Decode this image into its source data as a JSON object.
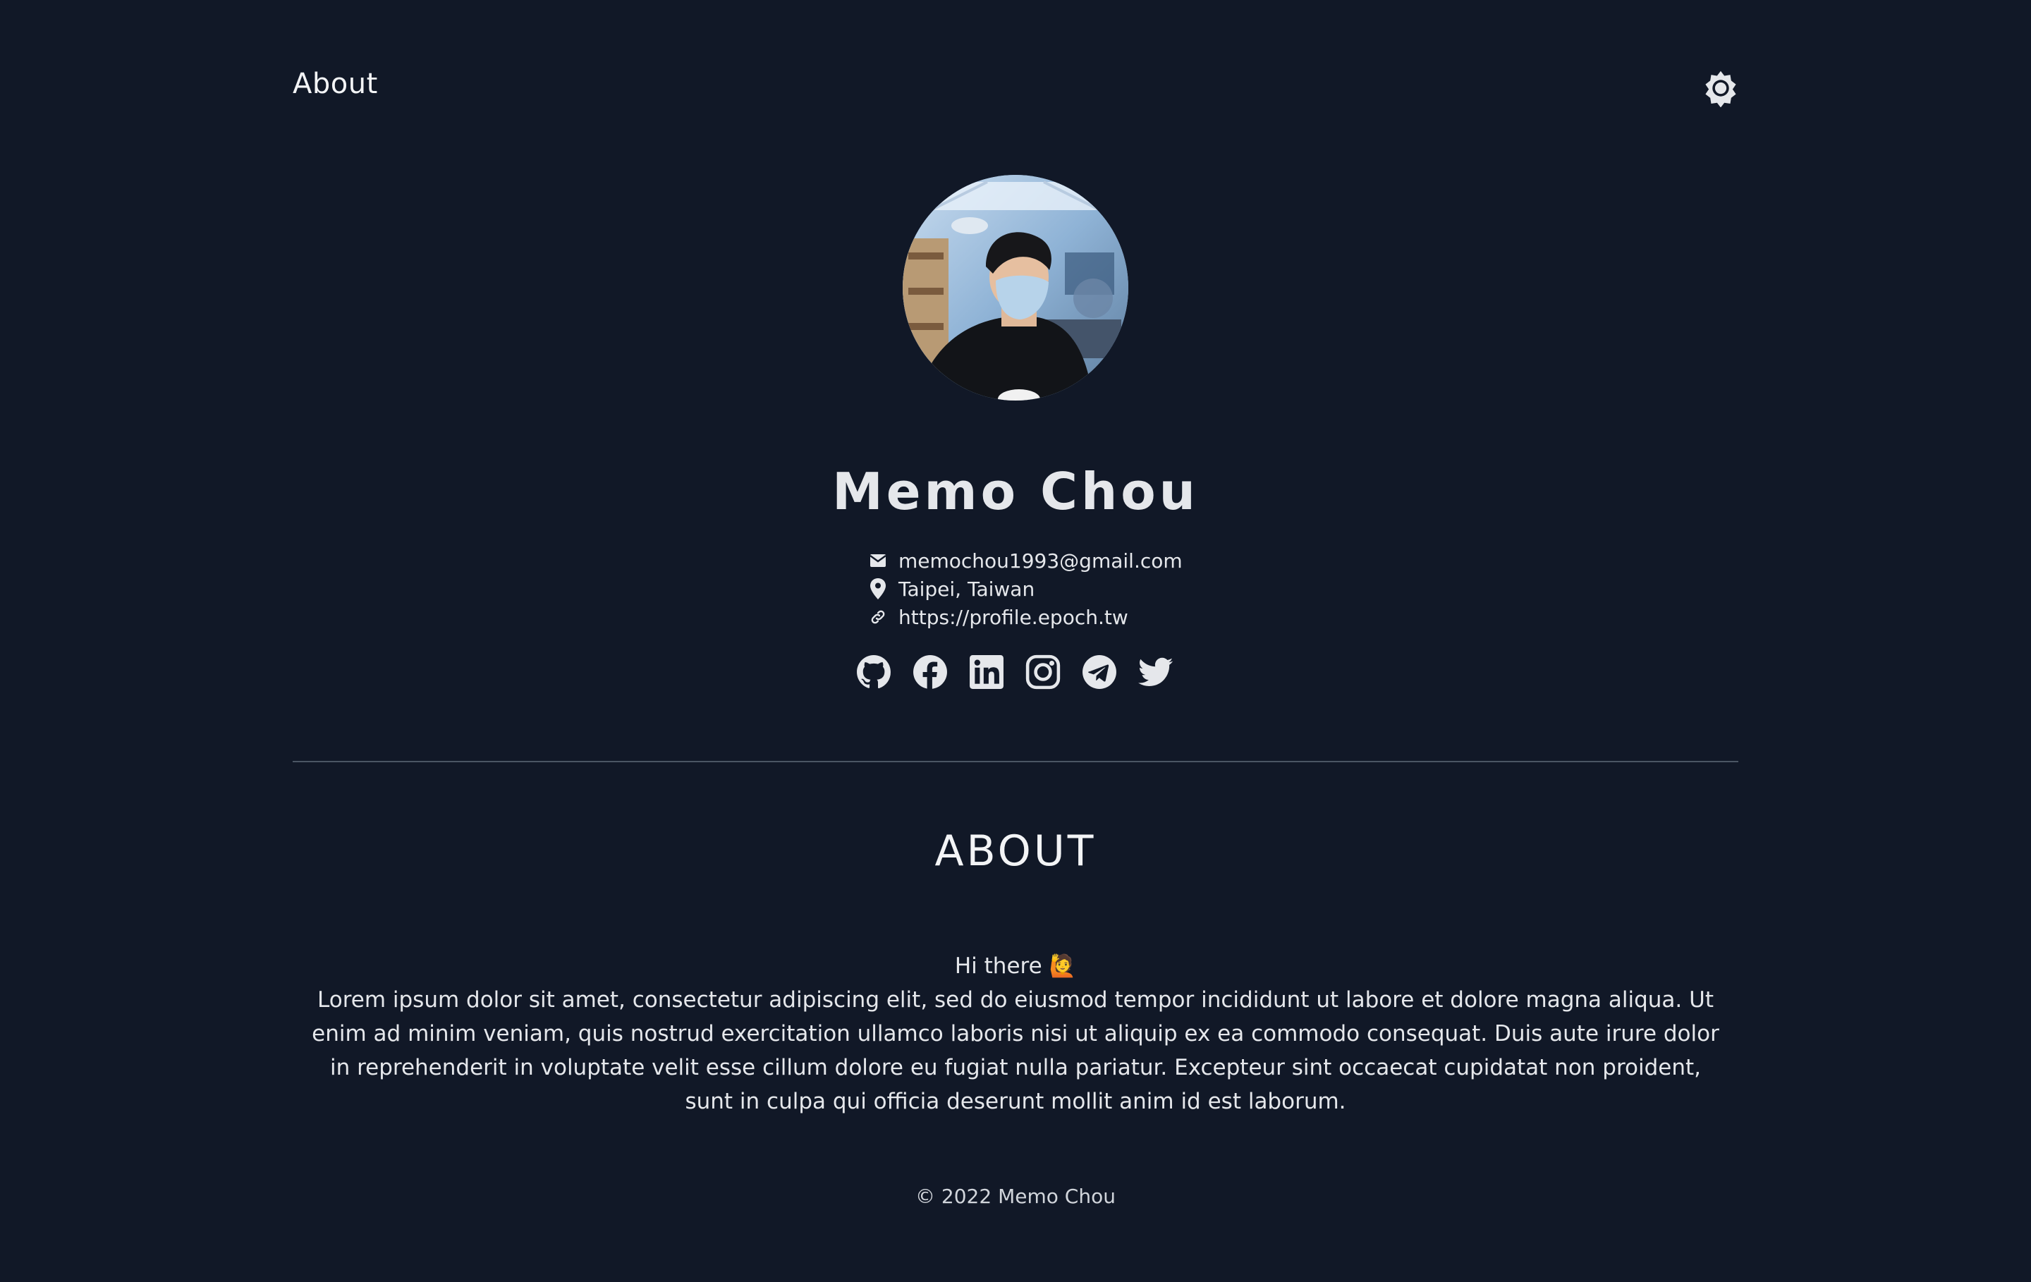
{
  "nav": {
    "title": "About"
  },
  "theme_toggle": {
    "icon": "sun-gear-icon"
  },
  "profile": {
    "name": "Memo Chou",
    "email": "memochou1993@gmail.com",
    "location": "Taipei, Taiwan",
    "website": "https://profile.epoch.tw"
  },
  "socials": [
    {
      "icon": "github-icon"
    },
    {
      "icon": "facebook-icon"
    },
    {
      "icon": "linkedin-icon"
    },
    {
      "icon": "instagram-icon"
    },
    {
      "icon": "telegram-icon"
    },
    {
      "icon": "twitter-icon"
    }
  ],
  "about": {
    "heading": "ABOUT",
    "greeting": "Hi there 🙋",
    "body": "Lorem ipsum dolor sit amet, consectetur adipiscing elit, sed do eiusmod tempor incididunt ut labore et dolore magna aliqua. Ut enim ad minim veniam, quis nostrud exercitation ullamco laboris nisi ut aliquip ex ea commodo consequat. Duis aute irure dolor in reprehenderit in voluptate velit esse cillum dolore eu fugiat nulla pariatur. Excepteur sint occaecat cupidatat non proident, sunt in culpa qui officia deserunt mollit anim id est laborum."
  },
  "footer": {
    "text": "© 2022 Memo Chou"
  },
  "colors": {
    "background": "#111827",
    "text": "#e5e7eb",
    "divider": "#4b5563"
  }
}
